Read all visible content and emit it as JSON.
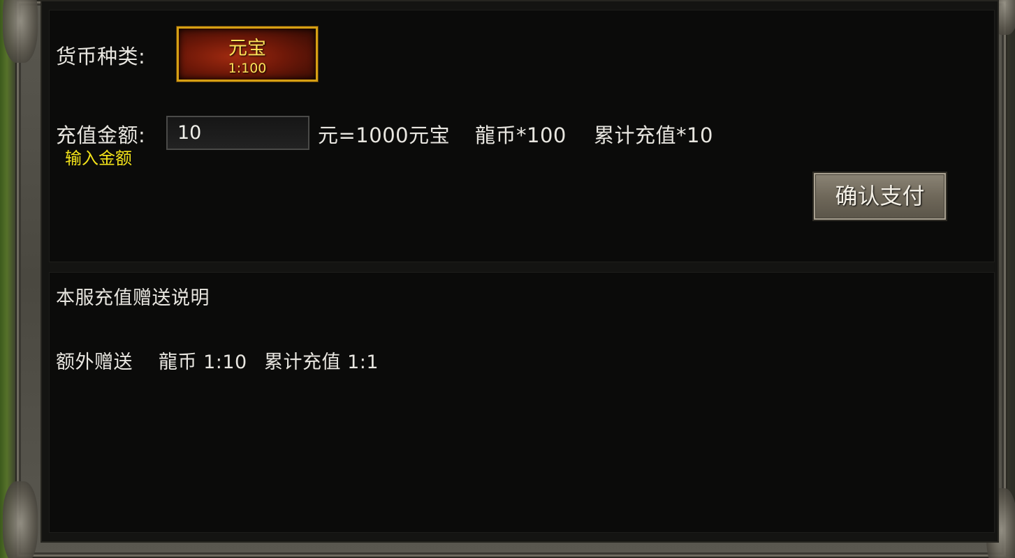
{
  "recharge": {
    "currency_type_label": "货币种类:",
    "currency": {
      "name": "元宝",
      "rate": "1:100"
    },
    "amount_label": "充值金额:",
    "amount_value": "10",
    "amount_hint": "输入金额",
    "conversion_text": "元=1000元宝",
    "dragon_coin_text": "龍币*100",
    "cumulative_text": "累计充值*10",
    "confirm_label": "确认支付"
  },
  "bonus_info": {
    "title": "本服充值赠送说明",
    "extra_label": "额外赠送",
    "dragon_coin_ratio": "龍币 1:10",
    "cumulative_ratio": "累计充值 1:1"
  },
  "colors": {
    "accent_gold": "#d6a014",
    "hint_yellow": "#f2e21a",
    "text_light": "#e8e6e0"
  }
}
